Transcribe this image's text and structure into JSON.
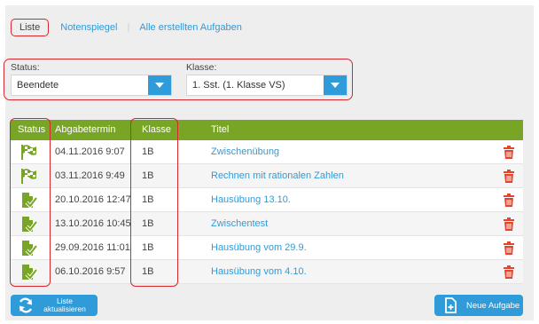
{
  "tabs": [
    {
      "label": "Liste",
      "active": true
    },
    {
      "label": "Notenspiegel",
      "active": false
    },
    {
      "label": "Alle erstellten Aufgaben",
      "active": false
    }
  ],
  "filters": {
    "status": {
      "label": "Status:",
      "value": "Beendete"
    },
    "klasse": {
      "label": "Klasse:",
      "value": "1. Sst. (1. Klasse VS)"
    }
  },
  "table": {
    "headers": [
      "Status",
      "Abgabetermin",
      "Klasse",
      "Titel"
    ],
    "rows": [
      {
        "status_icon": "finish-flag-icon",
        "date": "04.11.2016 9:07",
        "klasse": "1B",
        "titel": "Zwischenübung"
      },
      {
        "status_icon": "finish-flag-icon",
        "date": "03.11.2016 9:49",
        "klasse": "1B",
        "titel": "Rechnen mit rationalen Zahlen"
      },
      {
        "status_icon": "graded-check-icon",
        "date": "20.10.2016 12:47",
        "klasse": "1B",
        "titel": "Hausübung 13.10."
      },
      {
        "status_icon": "graded-check-icon",
        "date": "13.10.2016 10:45",
        "klasse": "1B",
        "titel": "Zwischentest"
      },
      {
        "status_icon": "graded-check-icon",
        "date": "29.09.2016 11:01",
        "klasse": "1B",
        "titel": "Hausübung vom 29.9."
      },
      {
        "status_icon": "graded-check-icon",
        "date": "06.10.2016 9:57",
        "klasse": "1B",
        "titel": "Hausübung vom 4.10."
      }
    ]
  },
  "buttons": {
    "refresh_line1": "Liste",
    "refresh_line2": "aktualisieren",
    "new_task": "Neue Aufgabe"
  },
  "colors": {
    "accent_blue": "#2f9bd8",
    "header_green": "#78a526",
    "delete_red": "#e2462e",
    "highlight_red": "#d9262c"
  }
}
